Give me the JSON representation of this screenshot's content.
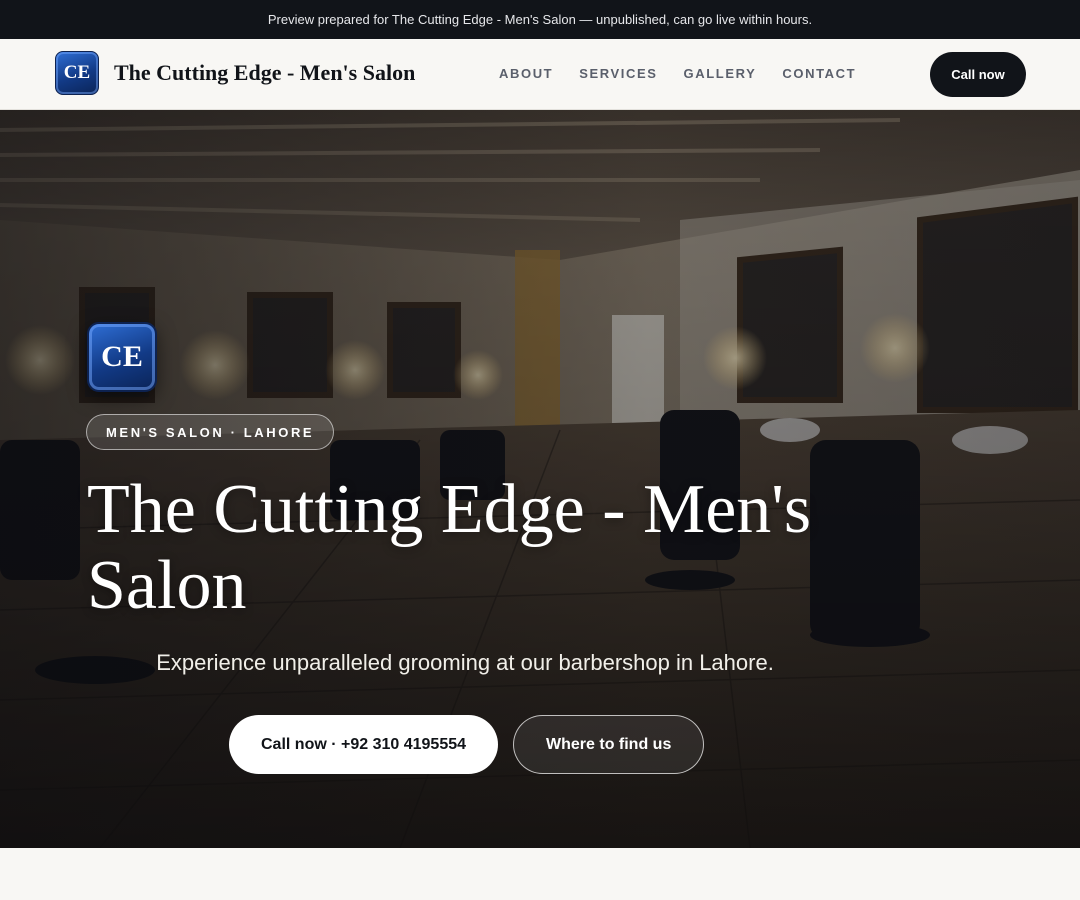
{
  "banner": {
    "text": "Preview prepared for The Cutting Edge - Men's Salon — unpublished, can go live within hours."
  },
  "header": {
    "logo_text": "CE",
    "brand_name": "The Cutting Edge - Men's Salon",
    "nav": [
      {
        "label": "ABOUT"
      },
      {
        "label": "SERVICES"
      },
      {
        "label": "GALLERY"
      },
      {
        "label": "CONTACT"
      }
    ],
    "cta_label": "Call now"
  },
  "hero": {
    "logo_text": "CE",
    "eyebrow": "MEN'S SALON · LAHORE",
    "title": "The Cutting Edge - Men's Salon",
    "subtitle": "Experience unparalleled grooming at our barbershop in Lahore.",
    "primary_button": "Call now · +92 310 4195554",
    "secondary_button": "Where to find us"
  },
  "colors": {
    "dark": "#111419",
    "light_bg": "#f8f7f4",
    "logo_blue": "#123a86"
  }
}
